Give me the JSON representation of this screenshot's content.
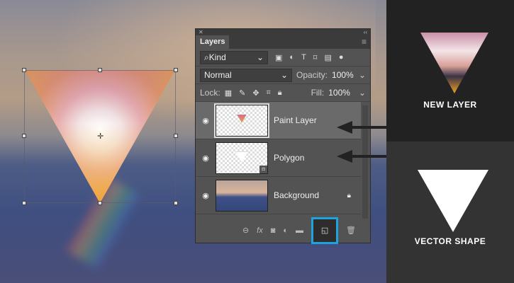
{
  "panel": {
    "title": "Layers",
    "filter": "Kind",
    "blend_mode": "Normal",
    "opacity_label": "Opacity:",
    "opacity": "100%",
    "lock_label": "Lock:",
    "fill_label": "Fill:",
    "fill": "100%",
    "layers": [
      {
        "name": "Paint Layer",
        "active": true
      },
      {
        "name": "Polygon"
      },
      {
        "name": "Background",
        "locked": true
      }
    ],
    "footer_icons": [
      "link-icon",
      "fx-icon",
      "mask-icon",
      "adjustment-icon",
      "folder-icon",
      "new-layer-icon",
      "trash-icon"
    ],
    "fx_label": "fx"
  },
  "captions": {
    "new_layer": "NEW LAYER",
    "vector_shape": "VECTOR SHAPE"
  },
  "colors": {
    "highlight": "#1ea3dc"
  }
}
